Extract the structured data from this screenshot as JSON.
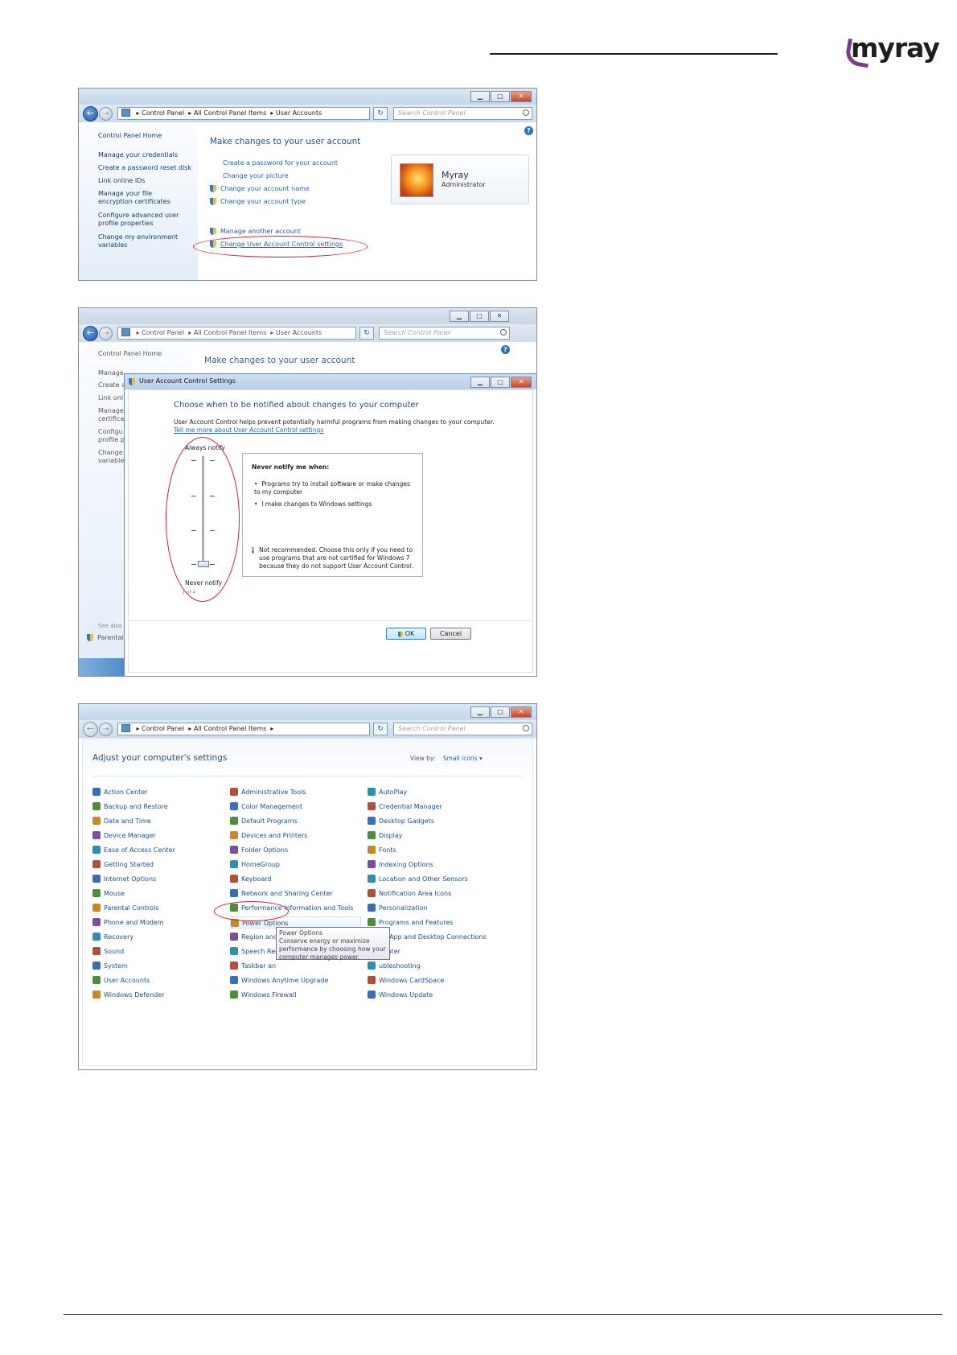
{
  "brand": {
    "logo_text": "myray",
    "accent": "#7a3d8e"
  },
  "address": {
    "control_panel": "Control Panel",
    "all_items": "All Control Panel Items",
    "user_accounts": "User Accounts",
    "search_placeholder": "Search Control Panel"
  },
  "window1": {
    "sidebar": {
      "home": "Control Panel Home",
      "items": [
        "Manage your credentials",
        "Create a password reset disk",
        "Link online IDs",
        "Manage your file encryption certificates",
        "Configure advanced user profile properties",
        "Change my environment variables"
      ]
    },
    "title": "Make changes to your user account",
    "links": [
      "Create a password for your account",
      "Change your picture",
      "Change your account name",
      "Change your account type",
      "Manage another account",
      "Change User Account Control settings"
    ],
    "user": {
      "name": "Myray",
      "role": "Administrator"
    }
  },
  "window2": {
    "sidebar_fragments": [
      "Control Panel Home",
      "Manage",
      "Create a",
      "Link onl",
      "Manage",
      "certifica",
      "Configu",
      "profile p",
      "Change",
      "variable",
      "See also",
      "Parental"
    ],
    "bg_title": "Make changes to your user account",
    "dialog": {
      "title": "User Account Control Settings",
      "heading": "Choose when to be notified about changes to your computer",
      "desc": "User Account Control helps prevent potentially harmful programs from making changes to your computer.",
      "tell_more": "Tell me more about User Account Control settings",
      "always": "Always notify",
      "never": "Never notify",
      "level_text": "1 of 4",
      "box_title": "Never notify me when:",
      "bullets": [
        "Programs try to install software or make changes to my computer",
        "I make changes to Windows settings"
      ],
      "warning": "Not recommended. Choose this only if you need to use programs that are not certified for Windows 7 because they do not support User Account Control.",
      "ok": "OK",
      "cancel": "Cancel"
    }
  },
  "window3": {
    "address_control_panel": "Control Panel",
    "address_all_items": "All Control Panel Items",
    "title": "Adjust your computer's settings",
    "view_by_label": "View by:",
    "view_by_value": "Small icons",
    "col1": [
      "Action Center",
      "Backup and Restore",
      "Date and Time",
      "Device Manager",
      "Ease of Access Center",
      "Getting Started",
      "Internet Options",
      "Mouse",
      "Parental Controls",
      "Phone and Modem",
      "Recovery",
      "Sound",
      "System",
      "User Accounts",
      "Windows Defender"
    ],
    "col2": [
      "Administrative Tools",
      "Color Management",
      "Default Programs",
      "Devices and Printers",
      "Folder Options",
      "HomeGroup",
      "Keyboard",
      "Network and Sharing Center",
      "Performance Information and Tools",
      "Power Options",
      "Region and",
      "Speech Rec",
      "Taskbar an",
      "Windows Anytime Upgrade",
      "Windows Firewall"
    ],
    "col3": [
      "AutoPlay",
      "Credential Manager",
      "Desktop Gadgets",
      "Display",
      "Fonts",
      "Indexing Options",
      "Location and Other Sensors",
      "Notification Area Icons",
      "Personalization",
      "Programs and Features",
      "RemoteApp and Desktop Connections",
      "Center",
      "Troubleshooting",
      "Windows CardSpace",
      "Windows Update"
    ],
    "col3_display": [
      "AutoPlay",
      "Credential Manager",
      "Desktop Gadgets",
      "Display",
      "Fonts",
      "Indexing Options",
      "Location and Other Sensors",
      "Notification Area Icons",
      "Personalization",
      "Programs and Features",
      "oteApp and Desktop Connections",
      "Center",
      "ubleshooting",
      "Windows CardSpace",
      "Windows Update"
    ],
    "tooltip": {
      "title": "Power Options",
      "l1": "Conserve energy or maximize",
      "l2": "performance by choosing how your",
      "l3": "computer manages power."
    }
  }
}
